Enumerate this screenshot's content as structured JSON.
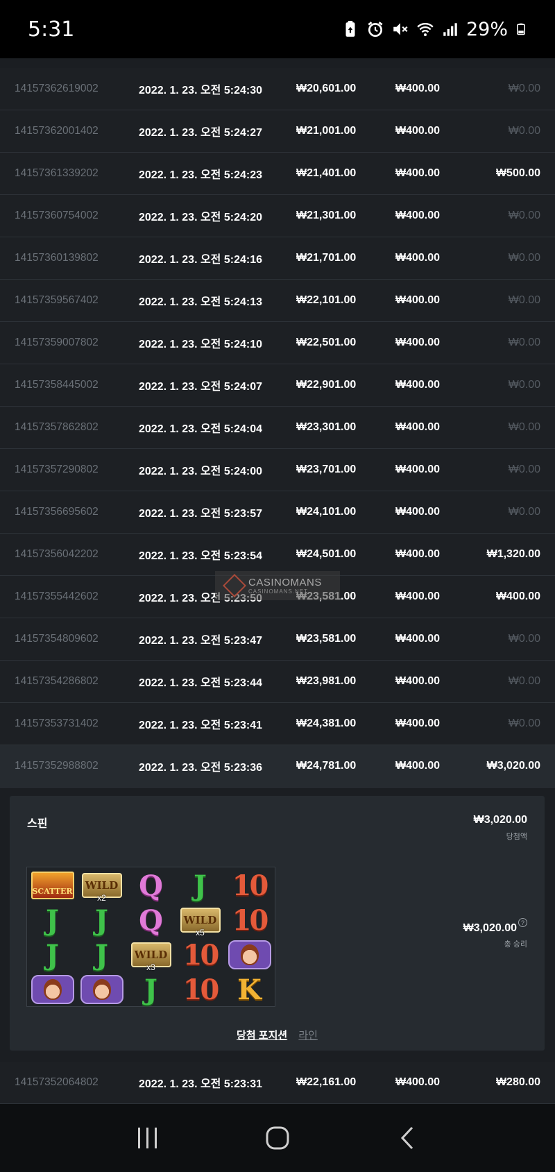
{
  "status_bar": {
    "time": "5:31",
    "battery": "29%",
    "icons": [
      "battery-saver-icon",
      "alarm-icon",
      "mute-icon",
      "wifi-icon",
      "signal-icon",
      "battery-icon"
    ]
  },
  "rows_top": [
    {
      "id": "14157362619002",
      "date": "2022. 1. 23. 오전 5:24:30",
      "balance": "₩20,601.00",
      "bet": "₩400.00",
      "win": "₩0.00",
      "win_zero": true
    },
    {
      "id": "14157362001402",
      "date": "2022. 1. 23. 오전 5:24:27",
      "balance": "₩21,001.00",
      "bet": "₩400.00",
      "win": "₩0.00",
      "win_zero": true
    },
    {
      "id": "14157361339202",
      "date": "2022. 1. 23. 오전 5:24:23",
      "balance": "₩21,401.00",
      "bet": "₩400.00",
      "win": "₩500.00",
      "win_zero": false
    },
    {
      "id": "14157360754002",
      "date": "2022. 1. 23. 오전 5:24:20",
      "balance": "₩21,301.00",
      "bet": "₩400.00",
      "win": "₩0.00",
      "win_zero": true
    },
    {
      "id": "14157360139802",
      "date": "2022. 1. 23. 오전 5:24:16",
      "balance": "₩21,701.00",
      "bet": "₩400.00",
      "win": "₩0.00",
      "win_zero": true
    },
    {
      "id": "14157359567402",
      "date": "2022. 1. 23. 오전 5:24:13",
      "balance": "₩22,101.00",
      "bet": "₩400.00",
      "win": "₩0.00",
      "win_zero": true
    },
    {
      "id": "14157359007802",
      "date": "2022. 1. 23. 오전 5:24:10",
      "balance": "₩22,501.00",
      "bet": "₩400.00",
      "win": "₩0.00",
      "win_zero": true
    },
    {
      "id": "14157358445002",
      "date": "2022. 1. 23. 오전 5:24:07",
      "balance": "₩22,901.00",
      "bet": "₩400.00",
      "win": "₩0.00",
      "win_zero": true
    },
    {
      "id": "14157357862802",
      "date": "2022. 1. 23. 오전 5:24:04",
      "balance": "₩23,301.00",
      "bet": "₩400.00",
      "win": "₩0.00",
      "win_zero": true
    },
    {
      "id": "14157357290802",
      "date": "2022. 1. 23. 오전 5:24:00",
      "balance": "₩23,701.00",
      "bet": "₩400.00",
      "win": "₩0.00",
      "win_zero": true
    },
    {
      "id": "14157356695602",
      "date": "2022. 1. 23. 오전 5:23:57",
      "balance": "₩24,101.00",
      "bet": "₩400.00",
      "win": "₩0.00",
      "win_zero": true
    },
    {
      "id": "14157356042202",
      "date": "2022. 1. 23. 오전 5:23:54",
      "balance": "₩24,501.00",
      "bet": "₩400.00",
      "win": "₩1,320.00",
      "win_zero": false
    },
    {
      "id": "14157355442602",
      "date": "2022. 1. 23. 오전 5:23:50",
      "balance": "₩23,581.00",
      "bet": "₩400.00",
      "win": "₩400.00",
      "win_zero": false
    },
    {
      "id": "14157354809602",
      "date": "2022. 1. 23. 오전 5:23:47",
      "balance": "₩23,581.00",
      "bet": "₩400.00",
      "win": "₩0.00",
      "win_zero": true
    },
    {
      "id": "14157354286802",
      "date": "2022. 1. 23. 오전 5:23:44",
      "balance": "₩23,981.00",
      "bet": "₩400.00",
      "win": "₩0.00",
      "win_zero": true
    },
    {
      "id": "14157353731402",
      "date": "2022. 1. 23. 오전 5:23:41",
      "balance": "₩24,381.00",
      "bet": "₩400.00",
      "win": "₩0.00",
      "win_zero": true
    },
    {
      "id": "14157352988802",
      "date": "2022. 1. 23. 오전 5:23:36",
      "balance": "₩24,781.00",
      "bet": "₩400.00",
      "win": "₩3,020.00",
      "win_zero": false
    }
  ],
  "detail": {
    "spin_title": "스핀",
    "win_amount": "₩3,020.00",
    "win_label": "당첨액",
    "total_amount": "₩3,020.00",
    "total_label": "총 승리",
    "help": "?",
    "tab_positions": "당첨 포지션",
    "tab_lines": "라인",
    "reels": [
      [
        {
          "t": "scatter",
          "label": "SCATTER"
        },
        {
          "t": "wild",
          "label": "WILD",
          "mult": "x2"
        },
        {
          "t": "q",
          "label": "Q"
        },
        {
          "t": "j",
          "label": "J"
        },
        {
          "t": "10",
          "label": "10"
        }
      ],
      [
        {
          "t": "j",
          "label": "J"
        },
        {
          "t": "j",
          "label": "J"
        },
        {
          "t": "q",
          "label": "Q"
        },
        {
          "t": "wild",
          "label": "WILD",
          "mult": "x5"
        },
        {
          "t": "10",
          "label": "10"
        }
      ],
      [
        {
          "t": "j",
          "label": "J"
        },
        {
          "t": "j",
          "label": "J"
        },
        {
          "t": "wild",
          "label": "WILD",
          "mult": "x3"
        },
        {
          "t": "10",
          "label": "10"
        },
        {
          "t": "lady",
          "label": ""
        }
      ],
      [
        {
          "t": "lady",
          "label": ""
        },
        {
          "t": "lady",
          "label": ""
        },
        {
          "t": "j",
          "label": "J"
        },
        {
          "t": "10",
          "label": "10"
        },
        {
          "t": "k",
          "label": "K"
        }
      ]
    ]
  },
  "row_bottom": {
    "id": "14157352064802",
    "date": "2022. 1. 23. 오전 5:23:31",
    "balance": "₩22,161.00",
    "bet": "₩400.00",
    "win": "₩280.00",
    "win_zero": false
  },
  "watermark": {
    "brand": "CASINOMANS",
    "url": "CASINOMANS.NET"
  },
  "nav": {
    "icons": [
      "recent-apps-icon",
      "home-icon",
      "back-icon"
    ]
  }
}
